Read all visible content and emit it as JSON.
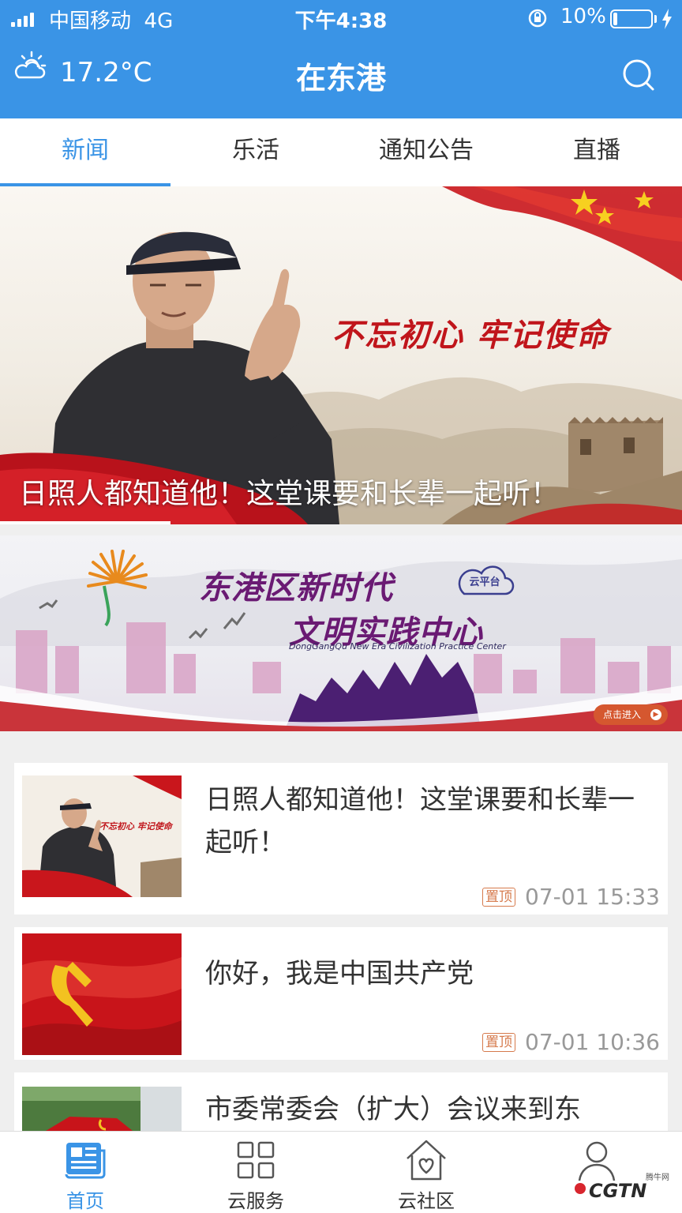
{
  "status_bar": {
    "carrier": "中国移动",
    "network": "4G",
    "time": "下午4:38",
    "battery": "10%",
    "battery_level": 0.1
  },
  "header": {
    "temperature": "17.2°C",
    "title": "在东港",
    "weather_icon": "partly-cloudy-icon",
    "search_icon": "search-icon"
  },
  "tabs": [
    {
      "label": "新闻",
      "active": true
    },
    {
      "label": "乐活",
      "active": false
    },
    {
      "label": "通知公告",
      "active": false
    },
    {
      "label": "直播",
      "active": false
    }
  ],
  "hero": {
    "slogan": "不忘初心 牢记使命",
    "caption": "日照人都知道他！这堂课要和长辈一起听！"
  },
  "banner": {
    "title_line1": "东港区新时代",
    "title_line2": "文明实践中心",
    "subtitle": "DongGangQu New Era Civilization Practice Center",
    "cloud_label": "云平台",
    "button": "点击进入"
  },
  "news": [
    {
      "title": "日照人都知道他！这堂课要和长辈一起听！",
      "badge": "置顶",
      "time": "07-01 15:33",
      "thumb_slogan": "不忘初心 牢记使命"
    },
    {
      "title": "你好，我是中国共产党",
      "badge": "置顶",
      "time": "07-01 10:36"
    },
    {
      "title": "市委常委会（扩大）会议来到东"
    }
  ],
  "bottom_nav": [
    {
      "label": "首页",
      "icon": "news-icon",
      "active": true
    },
    {
      "label": "云服务",
      "icon": "grid-icon",
      "active": false
    },
    {
      "label": "云社区",
      "icon": "house-heart-icon",
      "active": false
    },
    {
      "label": "",
      "icon": "person-icon",
      "active": false
    }
  ],
  "watermark": {
    "text": "CGTN",
    "small": "腾牛网"
  },
  "colors": {
    "primary": "#3a94e6",
    "red": "#c0151b",
    "purple": "#6a1a73",
    "badge": "#d67a4c"
  }
}
